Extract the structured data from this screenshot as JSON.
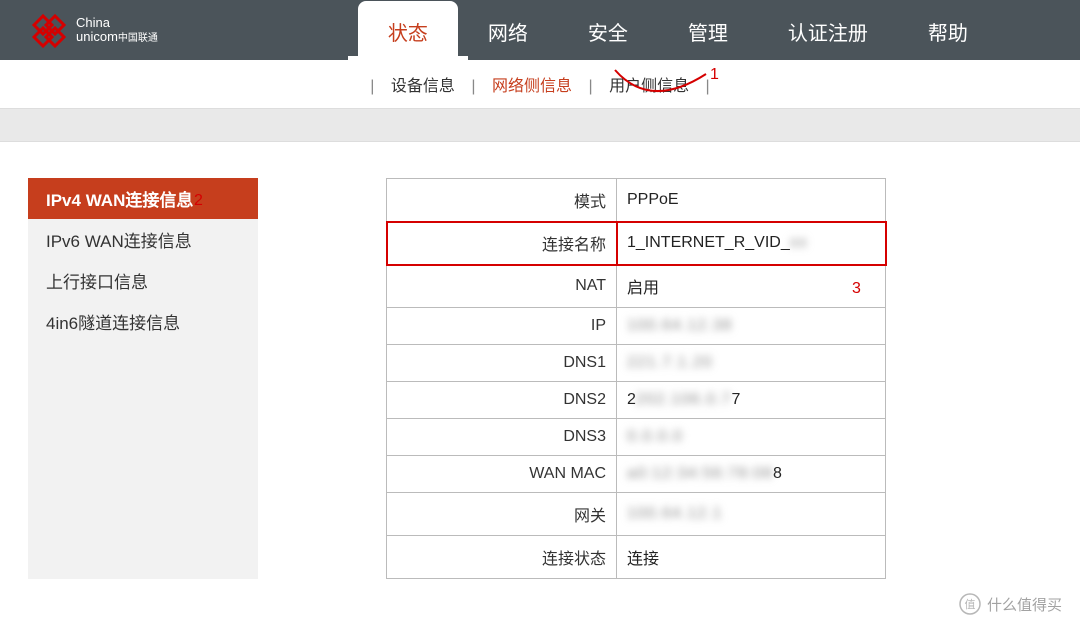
{
  "brand": {
    "line1": "China",
    "line2": "unicom",
    "cn": "中国联通"
  },
  "nav": {
    "items": [
      "状态",
      "网络",
      "安全",
      "管理",
      "认证注册",
      "帮助"
    ],
    "activeIndex": 0
  },
  "subnav": {
    "items": [
      "设备信息",
      "网络侧信息",
      "用户侧信息"
    ],
    "activeIndex": 1
  },
  "sidebar": {
    "items": [
      "IPv4 WAN连接信息",
      "IPv6 WAN连接信息",
      "上行接口信息",
      "4in6隧道连接信息"
    ],
    "activeIndex": 0
  },
  "table": {
    "rows": [
      {
        "label": "模式",
        "value": "PPPoE",
        "blur": false
      },
      {
        "label": "连接名称",
        "value": "1_INTERNET_R_VID_",
        "blur": false,
        "highlight": true,
        "trailingBlur": "xx"
      },
      {
        "label": "NAT",
        "value": "启用",
        "blur": false
      },
      {
        "label": "IP",
        "value": "100.64.12.38",
        "blur": true
      },
      {
        "label": "DNS1",
        "value": "221.7.1.20",
        "blur": true
      },
      {
        "label": "DNS2",
        "value": "202.106.0.7",
        "blur": true,
        "prefix": "2",
        "suffix": "7"
      },
      {
        "label": "DNS3",
        "value": "0.0.0.0",
        "blur": true
      },
      {
        "label": "WAN MAC",
        "value": "a0:12:34:56:78:08",
        "blur": true,
        "suffix": "8"
      },
      {
        "label": "网关",
        "value": "100.64.12.1",
        "blur": true
      },
      {
        "label": "连接状态",
        "value": "连接",
        "blur": false
      }
    ]
  },
  "annotations": {
    "a1": "1",
    "a2": "2",
    "a3": "3"
  },
  "watermark": {
    "text": "什么值得买"
  }
}
